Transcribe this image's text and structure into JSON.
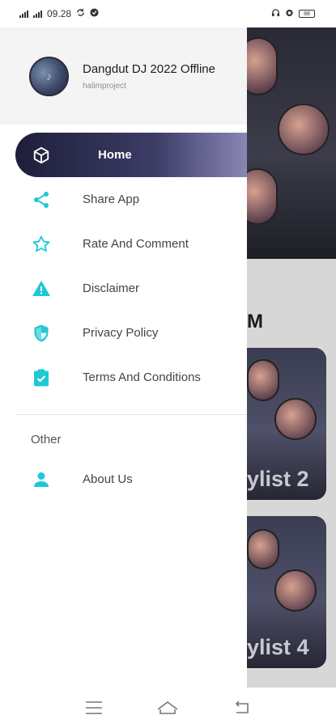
{
  "status": {
    "time": "09.28",
    "battery": "88"
  },
  "drawer": {
    "title": "Dangdut DJ 2022 Offline",
    "subtitle": "halimproject",
    "items": [
      {
        "label": "Home",
        "icon": "cube-icon"
      },
      {
        "label": "Share App",
        "icon": "share-icon"
      },
      {
        "label": "Rate And Comment",
        "icon": "star-icon"
      },
      {
        "label": "Disclaimer",
        "icon": "warning-icon"
      },
      {
        "label": "Privacy Policy",
        "icon": "shield-icon"
      },
      {
        "label": "Terms And Conditions",
        "icon": "clipboard-check-icon"
      }
    ],
    "section_title": "Other",
    "about_label": "About Us"
  },
  "background": {
    "heading_fragment": "M",
    "card_labels": [
      "ylist 2",
      "ylist 4"
    ]
  },
  "colors": {
    "accent": "#1ec8d6",
    "active_bg": "#1e1e3a"
  }
}
